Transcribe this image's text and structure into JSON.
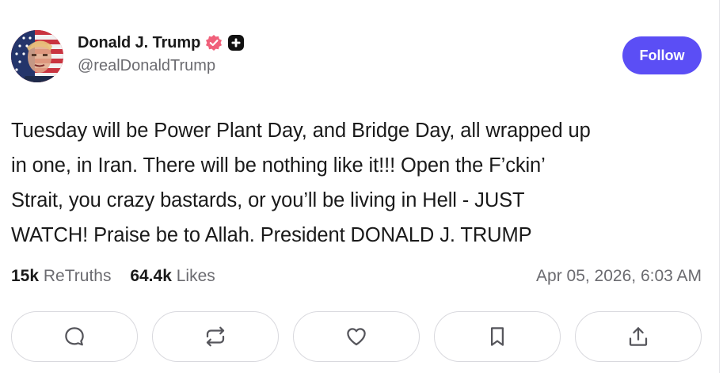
{
  "author": {
    "display_name": "Donald J. Trump",
    "handle": "@realDonaldTrump",
    "verified_badge_color": "#f0607a",
    "plus_badge_color": "#111111"
  },
  "follow_button": {
    "label": "Follow",
    "color": "#5b4ef5"
  },
  "post": {
    "lines": [
      "Tuesday will be Power Plant Day, and Bridge Day, all wrapped up",
      "in one, in Iran. There will be nothing like it!!! Open the F’ckin’",
      "Strait, you crazy bastards, or you’ll be living in Hell - JUST",
      "WATCH! Praise be to Allah. President DONALD J. TRUMP"
    ]
  },
  "stats": {
    "retruths_count": "15k",
    "retruths_label": "ReTruths",
    "likes_count": "64.4k",
    "likes_label": "Likes",
    "timestamp": "Apr 05, 2026, 6:03 AM"
  },
  "actions": [
    {
      "icon": "reply-icon"
    },
    {
      "icon": "retruth-icon"
    },
    {
      "icon": "like-icon"
    },
    {
      "icon": "bookmark-icon"
    },
    {
      "icon": "share-icon"
    }
  ]
}
